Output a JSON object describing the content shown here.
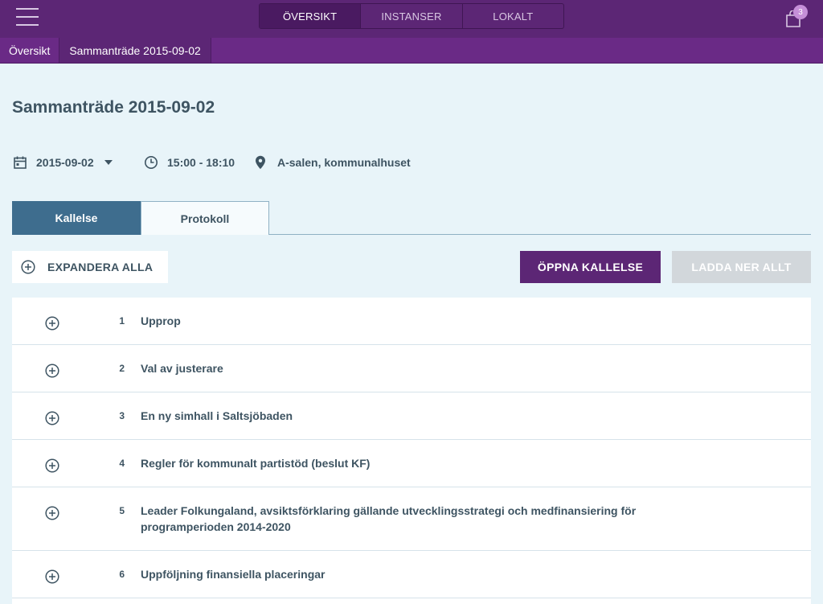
{
  "topbar": {
    "tabs": [
      "ÖVERSIKT",
      "INSTANSER",
      "LOKALT"
    ],
    "active_tab": "ÖVERSIKT",
    "cart_count": "3"
  },
  "breadcrumb": [
    "Översikt",
    "Sammanträde 2015-09-02"
  ],
  "page": {
    "title": "Sammanträde 2015-09-02",
    "date": "2015-09-02",
    "time": "15:00 - 18:10",
    "location": "A-salen, kommunalhuset"
  },
  "tabs": {
    "kallelse": "Kallelse",
    "protokoll": "Protokoll"
  },
  "actions": {
    "expand_all": "EXPANDERA ALLA",
    "open": "ÖPPNA KALLELSE",
    "download": "LADDA NER ALLT"
  },
  "agenda": [
    {
      "num": "1",
      "title": "Upprop"
    },
    {
      "num": "2",
      "title": "Val av justerare"
    },
    {
      "num": "3",
      "title": "En ny simhall i Saltsjöbaden"
    },
    {
      "num": "4",
      "title": "Regler för kommunalt partistöd (beslut KF)"
    },
    {
      "num": "5",
      "title": "Leader Folkungaland, avsiktsförklaring gällande utvecklingsstrategi och medfinansiering för programperioden 2014-2020"
    },
    {
      "num": "6",
      "title": "Uppföljning finansiella placeringar"
    }
  ],
  "colors": {
    "brand_purple": "#5c2675",
    "active_tab_blue": "#3e6d8e",
    "page_background": "#e8f4f9",
    "text": "#3e5462"
  }
}
